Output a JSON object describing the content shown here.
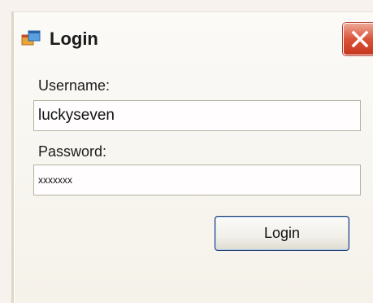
{
  "window": {
    "title": "Login"
  },
  "username": {
    "label": "Username:",
    "value": "luckyseven"
  },
  "password": {
    "label": "Password:",
    "value": "xxxxxxx"
  },
  "login_button": {
    "label": "Login"
  },
  "icons": {
    "app": "form-window-icon",
    "close": "close-x-icon"
  },
  "colors": {
    "close_button": "#d4492f",
    "button_border": "#1f3a6e",
    "window_background": "#f5f2ea"
  }
}
